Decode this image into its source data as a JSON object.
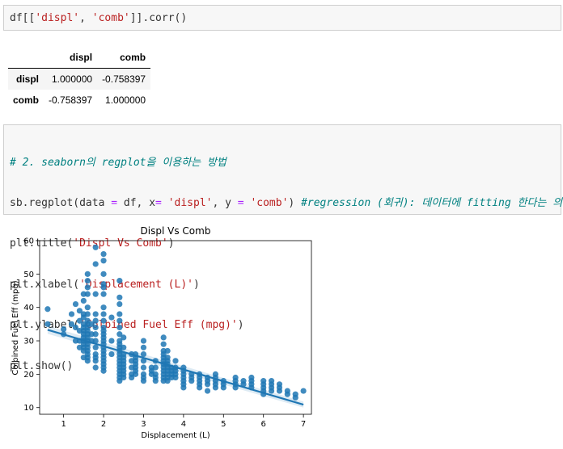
{
  "cell1": {
    "code": [
      [
        "df[[",
        "plain"
      ],
      [
        "'displ'",
        "str"
      ],
      [
        ", ",
        "plain"
      ],
      [
        "'comb'",
        "str"
      ],
      [
        "]].corr()",
        "plain"
      ]
    ]
  },
  "corr_table": {
    "columns": [
      "",
      "displ",
      "comb"
    ],
    "rows": [
      {
        "label": "displ",
        "values": [
          "1.000000",
          "-0.758397"
        ]
      },
      {
        "label": "comb",
        "values": [
          "-0.758397",
          "1.000000"
        ]
      }
    ]
  },
  "cell2": {
    "lines": [
      [
        [
          "# 2. seaborn의 regplot을 이용하는 방법",
          "cm"
        ]
      ],
      [
        [
          "sb.regplot(data ",
          "plain"
        ],
        [
          "=",
          "op"
        ],
        [
          " df, x",
          "plain"
        ],
        [
          "=",
          "op"
        ],
        [
          " ",
          "plain"
        ],
        [
          "'displ'",
          "str"
        ],
        [
          ", y ",
          "plain"
        ],
        [
          "=",
          "op"
        ],
        [
          " ",
          "plain"
        ],
        [
          "'comb'",
          "str"
        ],
        [
          ") ",
          "plain"
        ],
        [
          "#regression (회귀): 데이터에 fitting 한다는 의미!",
          "cm"
        ]
      ],
      [
        [
          "plt.title(",
          "plain"
        ],
        [
          "'Displ Vs Comb'",
          "str"
        ],
        [
          ")",
          "plain"
        ]
      ],
      [
        [
          "plt.xlabel(",
          "plain"
        ],
        [
          "'Displacement (L)'",
          "str"
        ],
        [
          ")",
          "plain"
        ]
      ],
      [
        [
          "plt.ylabel(",
          "plain"
        ],
        [
          "'Colbined Fuel Eff (mpg)'",
          "str"
        ],
        [
          ")",
          "plain"
        ]
      ],
      [
        [
          "plt.show()",
          "plain"
        ]
      ]
    ]
  },
  "chart_data": {
    "type": "scatter",
    "title": "Displ Vs Comb",
    "xlabel": "Displacement (L)",
    "ylabel": "Colbined Fuel Eff (mpg)",
    "xlim": [
      0.4,
      7.2
    ],
    "ylim": [
      8,
      60
    ],
    "xticks": [
      1,
      2,
      3,
      4,
      5,
      6,
      7
    ],
    "yticks": [
      10,
      20,
      30,
      40,
      50,
      60
    ],
    "color": "#1f77b4",
    "regression_line": {
      "x": [
        0.6,
        7.0
      ],
      "y": [
        33.3,
        10.9
      ]
    },
    "points": [
      [
        0.6,
        39.5
      ],
      [
        0.6,
        35
      ],
      [
        1.0,
        32
      ],
      [
        1.0,
        33.5
      ],
      [
        1.2,
        35
      ],
      [
        1.2,
        38
      ],
      [
        1.3,
        34
      ],
      [
        1.3,
        30
      ],
      [
        1.3,
        41
      ],
      [
        1.4,
        30
      ],
      [
        1.4,
        36
      ],
      [
        1.4,
        33
      ],
      [
        1.4,
        39
      ],
      [
        1.4,
        28
      ],
      [
        1.5,
        44
      ],
      [
        1.5,
        42
      ],
      [
        1.5,
        38
      ],
      [
        1.5,
        37
      ],
      [
        1.5,
        35
      ],
      [
        1.5,
        34
      ],
      [
        1.5,
        33
      ],
      [
        1.5,
        32
      ],
      [
        1.5,
        31
      ],
      [
        1.5,
        30
      ],
      [
        1.5,
        29
      ],
      [
        1.5,
        28
      ],
      [
        1.5,
        27
      ],
      [
        1.5,
        25
      ],
      [
        1.6,
        50
      ],
      [
        1.6,
        48
      ],
      [
        1.6,
        46
      ],
      [
        1.6,
        44
      ],
      [
        1.6,
        40
      ],
      [
        1.6,
        38
      ],
      [
        1.6,
        36
      ],
      [
        1.6,
        35
      ],
      [
        1.6,
        34
      ],
      [
        1.6,
        33
      ],
      [
        1.6,
        32
      ],
      [
        1.6,
        31
      ],
      [
        1.6,
        30
      ],
      [
        1.6,
        29
      ],
      [
        1.6,
        28
      ],
      [
        1.6,
        27
      ],
      [
        1.6,
        26
      ],
      [
        1.6,
        25
      ],
      [
        1.6,
        24
      ],
      [
        1.7,
        35
      ],
      [
        1.7,
        32
      ],
      [
        1.7,
        30
      ],
      [
        1.8,
        58
      ],
      [
        1.8,
        53
      ],
      [
        1.8,
        44
      ],
      [
        1.8,
        38
      ],
      [
        1.8,
        36
      ],
      [
        1.8,
        34
      ],
      [
        1.8,
        32
      ],
      [
        1.8,
        30
      ],
      [
        1.8,
        28
      ],
      [
        1.8,
        26
      ],
      [
        1.8,
        25
      ],
      [
        1.8,
        24
      ],
      [
        1.8,
        22
      ],
      [
        2.0,
        56
      ],
      [
        2.0,
        54
      ],
      [
        2.0,
        50
      ],
      [
        2.0,
        47
      ],
      [
        2.0,
        46
      ],
      [
        2.0,
        44
      ],
      [
        2.0,
        40
      ],
      [
        2.0,
        38
      ],
      [
        2.0,
        36
      ],
      [
        2.0,
        34
      ],
      [
        2.0,
        33
      ],
      [
        2.0,
        32
      ],
      [
        2.0,
        31
      ],
      [
        2.0,
        30
      ],
      [
        2.0,
        29
      ],
      [
        2.0,
        28
      ],
      [
        2.0,
        27
      ],
      [
        2.0,
        26
      ],
      [
        2.0,
        25
      ],
      [
        2.0,
        24
      ],
      [
        2.0,
        23
      ],
      [
        2.0,
        22
      ],
      [
        2.0,
        21
      ],
      [
        2.2,
        37
      ],
      [
        2.2,
        30
      ],
      [
        2.2,
        26
      ],
      [
        2.4,
        48
      ],
      [
        2.4,
        43
      ],
      [
        2.4,
        41
      ],
      [
        2.4,
        38
      ],
      [
        2.4,
        36
      ],
      [
        2.4,
        34
      ],
      [
        2.4,
        32
      ],
      [
        2.4,
        30
      ],
      [
        2.4,
        29
      ],
      [
        2.4,
        28
      ],
      [
        2.4,
        27
      ],
      [
        2.4,
        26
      ],
      [
        2.4,
        25
      ],
      [
        2.4,
        24
      ],
      [
        2.4,
        23
      ],
      [
        2.4,
        22
      ],
      [
        2.4,
        21
      ],
      [
        2.4,
        20
      ],
      [
        2.4,
        19
      ],
      [
        2.4,
        18
      ],
      [
        2.5,
        31
      ],
      [
        2.5,
        28
      ],
      [
        2.5,
        26
      ],
      [
        2.5,
        25
      ],
      [
        2.5,
        24
      ],
      [
        2.5,
        23
      ],
      [
        2.5,
        22
      ],
      [
        2.5,
        21
      ],
      [
        2.5,
        20
      ],
      [
        2.5,
        19
      ],
      [
        2.7,
        26
      ],
      [
        2.7,
        24
      ],
      [
        2.7,
        22
      ],
      [
        2.7,
        20
      ],
      [
        2.7,
        19
      ],
      [
        2.8,
        26
      ],
      [
        2.8,
        25
      ],
      [
        2.8,
        24
      ],
      [
        2.8,
        23
      ],
      [
        2.8,
        22
      ],
      [
        2.8,
        21
      ],
      [
        2.8,
        20
      ],
      [
        3.0,
        30
      ],
      [
        3.0,
        28
      ],
      [
        3.0,
        26
      ],
      [
        3.0,
        24
      ],
      [
        3.0,
        22
      ],
      [
        3.0,
        20
      ],
      [
        3.0,
        19
      ],
      [
        3.0,
        18
      ],
      [
        3.2,
        22
      ],
      [
        3.2,
        21
      ],
      [
        3.2,
        20
      ],
      [
        3.3,
        24
      ],
      [
        3.3,
        22
      ],
      [
        3.3,
        20
      ],
      [
        3.3,
        19
      ],
      [
        3.3,
        18
      ],
      [
        3.5,
        31
      ],
      [
        3.5,
        29
      ],
      [
        3.5,
        27
      ],
      [
        3.5,
        26
      ],
      [
        3.5,
        25
      ],
      [
        3.5,
        24
      ],
      [
        3.5,
        23
      ],
      [
        3.5,
        22
      ],
      [
        3.5,
        21
      ],
      [
        3.5,
        20
      ],
      [
        3.5,
        19
      ],
      [
        3.5,
        18
      ],
      [
        3.6,
        27
      ],
      [
        3.6,
        25
      ],
      [
        3.6,
        24
      ],
      [
        3.6,
        23
      ],
      [
        3.6,
        22
      ],
      [
        3.6,
        21
      ],
      [
        3.6,
        20
      ],
      [
        3.6,
        19
      ],
      [
        3.6,
        18
      ],
      [
        3.7,
        22
      ],
      [
        3.7,
        21
      ],
      [
        3.7,
        20
      ],
      [
        3.7,
        19
      ],
      [
        3.8,
        24
      ],
      [
        3.8,
        22
      ],
      [
        3.8,
        21
      ],
      [
        3.8,
        20
      ],
      [
        3.8,
        19
      ],
      [
        4.0,
        22
      ],
      [
        4.0,
        21
      ],
      [
        4.0,
        20
      ],
      [
        4.0,
        19
      ],
      [
        4.0,
        18
      ],
      [
        4.0,
        17
      ],
      [
        4.0,
        16
      ],
      [
        4.2,
        20
      ],
      [
        4.2,
        19
      ],
      [
        4.2,
        18
      ],
      [
        4.4,
        20
      ],
      [
        4.4,
        19
      ],
      [
        4.4,
        18
      ],
      [
        4.4,
        17
      ],
      [
        4.4,
        16
      ],
      [
        4.6,
        19
      ],
      [
        4.6,
        18
      ],
      [
        4.6,
        17
      ],
      [
        4.6,
        15
      ],
      [
        4.8,
        20
      ],
      [
        4.8,
        19
      ],
      [
        4.8,
        18
      ],
      [
        4.8,
        17
      ],
      [
        4.8,
        16
      ],
      [
        5.0,
        18
      ],
      [
        5.0,
        17
      ],
      [
        5.0,
        16
      ],
      [
        5.3,
        19
      ],
      [
        5.3,
        18
      ],
      [
        5.3,
        17
      ],
      [
        5.3,
        16
      ],
      [
        5.5,
        18
      ],
      [
        5.5,
        17
      ],
      [
        5.7,
        19
      ],
      [
        5.7,
        18
      ],
      [
        5.7,
        17
      ],
      [
        5.7,
        16
      ],
      [
        6.0,
        18
      ],
      [
        6.0,
        17
      ],
      [
        6.0,
        16
      ],
      [
        6.0,
        15
      ],
      [
        6.0,
        14
      ],
      [
        6.2,
        18
      ],
      [
        6.2,
        17
      ],
      [
        6.2,
        16
      ],
      [
        6.2,
        15
      ],
      [
        6.4,
        17
      ],
      [
        6.4,
        16
      ],
      [
        6.4,
        15
      ],
      [
        6.6,
        15
      ],
      [
        6.6,
        14
      ],
      [
        6.8,
        14
      ],
      [
        6.8,
        13
      ],
      [
        7.0,
        15
      ]
    ]
  }
}
